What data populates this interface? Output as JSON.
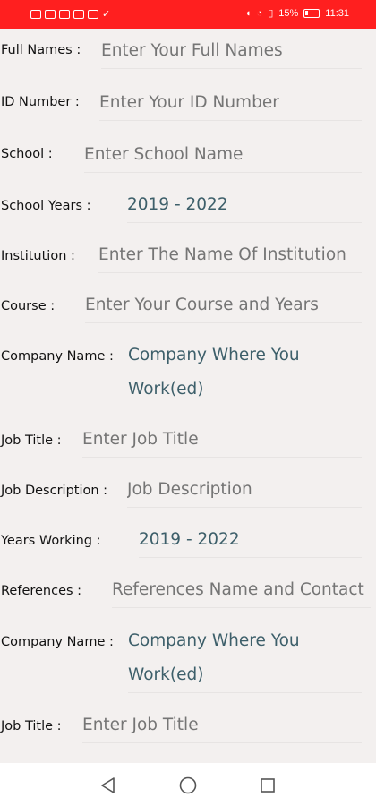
{
  "status_bar": {
    "battery": "15%",
    "time": "11:31"
  },
  "form": {
    "full_names": {
      "label": "Full Names :",
      "placeholder": "Enter Your Full Names"
    },
    "id_number": {
      "label": "ID Number :",
      "placeholder": "Enter Your ID Number"
    },
    "school": {
      "label": "School :",
      "placeholder": "Enter School Name"
    },
    "school_years": {
      "label": "School Years :",
      "value": "2019 - 2022"
    },
    "institution": {
      "label": "Institution :",
      "placeholder": "Enter The Name Of Institution"
    },
    "course": {
      "label": "Course :",
      "placeholder": "Enter Your Course and Years"
    },
    "company_name_1": {
      "label": "Company Name :",
      "placeholder": "Company Where You Work(ed)"
    },
    "job_title_1": {
      "label": "Job Title :",
      "placeholder": "Enter Job Title"
    },
    "job_description": {
      "label": "Job Description :",
      "placeholder": "Job Description"
    },
    "years_working": {
      "label": "Years Working :",
      "value": "2019 - 2022"
    },
    "references": {
      "label": "References :",
      "placeholder": "References Name and Contact"
    },
    "company_name_2": {
      "label": "Company Name :",
      "placeholder": "Company Where You Work(ed)"
    },
    "job_title_2": {
      "label": "Job Title :",
      "placeholder": "Enter Job Title"
    }
  },
  "nav": {
    "back_icon": "back-triangle-icon",
    "home_icon": "home-circle-icon",
    "recents_icon": "recents-square-icon"
  }
}
